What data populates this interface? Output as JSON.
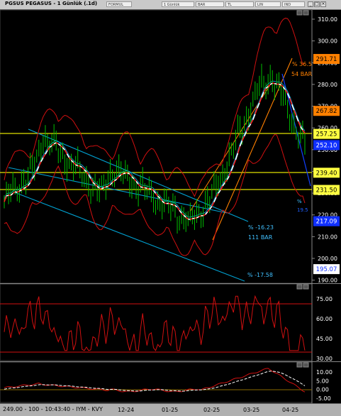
{
  "title": "PGSUS PEGASUS - 1 Günlük (.1d)",
  "toolbar": {
    "field1": "FORMUL",
    "field2": "1 Günlük",
    "field3": "BAR",
    "field4": "TL",
    "field5": "LIN",
    "field6": "IND"
  },
  "status_text": "249.00 - 100 - 10:43:40 - IYM - KVY",
  "x_ticks": [
    "12-24",
    "01-25",
    "02-25",
    "03-25",
    "04-25"
  ],
  "colors": {
    "background": "#000000",
    "bars": "#00c000",
    "bands": "#d01010",
    "channel": "#00a0d0",
    "uptrend": "#ff8000",
    "hline": "#e0e000",
    "rsi": "#d01010"
  },
  "main_panel": {
    "y_axis": [
      "310.00",
      "300.00",
      "290.00",
      "280.00",
      "270.00",
      "260.00",
      "250.00",
      "240.00",
      "230.00",
      "220.00",
      "210.00",
      "200.00",
      "190.00"
    ],
    "price_labels": [
      {
        "text": "291.71",
        "kind": "orange"
      },
      {
        "text": "267.82",
        "kind": "orange"
      },
      {
        "text": "257.25",
        "kind": "yellow"
      },
      {
        "text": "252.10",
        "kind": "blue"
      },
      {
        "text": "239.40",
        "kind": "yellow"
      },
      {
        "text": "231.50",
        "kind": "yellow"
      },
      {
        "text": "217.09",
        "kind": "blue"
      },
      {
        "text": "195.07",
        "kind": "white"
      }
    ],
    "annotations": {
      "up_pct": "% 36.5",
      "up_bars": "54 BAR",
      "down_pct": "% -16.23",
      "down_bars": "111 BAR",
      "lower_pct": "% -17.58",
      "mid_a": "%",
      "mid_b": "19.5"
    }
  },
  "rsi_panel": {
    "y_axis": [
      "75.00",
      "60.00",
      "45.00",
      "30.00"
    ]
  },
  "macd_panel": {
    "y_axis": [
      "10.00",
      "5.00",
      "0.00",
      "-5.00"
    ]
  }
}
